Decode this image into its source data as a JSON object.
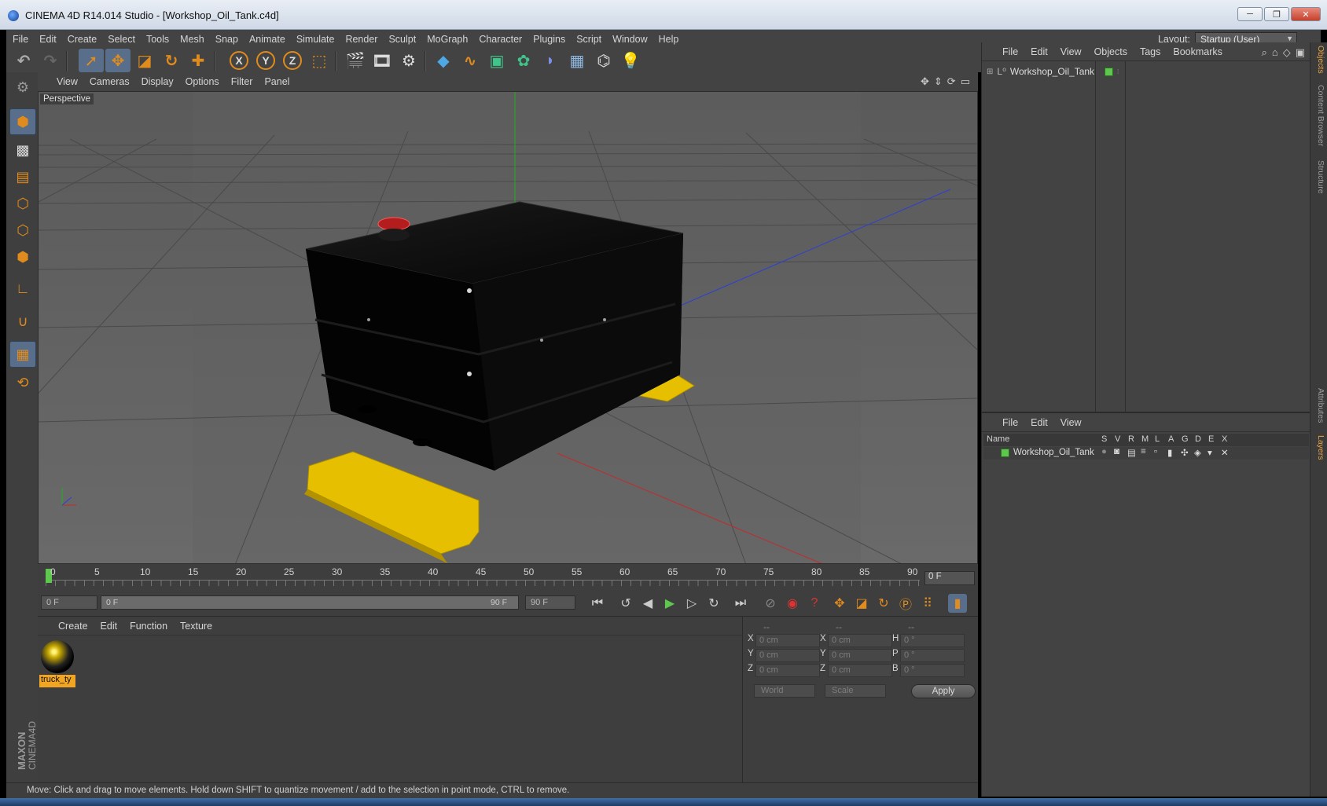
{
  "window": {
    "title": "CINEMA 4D R14.014 Studio - [Workshop_Oil_Tank.c4d]",
    "controls": [
      "─",
      "❐",
      "✕"
    ]
  },
  "menubar": {
    "items": [
      "File",
      "Edit",
      "Create",
      "Select",
      "Tools",
      "Mesh",
      "Snap",
      "Animate",
      "Simulate",
      "Render",
      "Sculpt",
      "MoGraph",
      "Character",
      "Plugins",
      "Script",
      "Window",
      "Help"
    ],
    "layout_label": "Layout:",
    "layout_value": "Startup (User)"
  },
  "toolbar": {
    "axis_labels": [
      "X",
      "Y",
      "Z"
    ],
    "icons": [
      "undo-icon",
      "redo-icon",
      "live-selection-icon",
      "move-icon",
      "scale-icon",
      "rotate-icon",
      "add-icon",
      "x-axis-icon",
      "y-axis-icon",
      "z-axis-icon",
      "coordinate-system-icon",
      "render-view-icon",
      "render-picture-viewer-icon",
      "edit-render-settings-icon",
      "cube-icon",
      "spline-icon",
      "nurbs-icon",
      "array-icon",
      "deformer-icon",
      "floor-icon",
      "camera-icon",
      "light-icon"
    ]
  },
  "viewport": {
    "menu": [
      "View",
      "Cameras",
      "Display",
      "Options",
      "Filter",
      "Panel"
    ],
    "label": "Perspective",
    "nav_icons": [
      "move-view-icon",
      "zoom-view-icon",
      "rotate-view-icon",
      "maximize-view-icon"
    ]
  },
  "timeline": {
    "ticks": [
      "0",
      "5",
      "10",
      "15",
      "20",
      "25",
      "30",
      "35",
      "40",
      "45",
      "50",
      "55",
      "60",
      "65",
      "70",
      "75",
      "80",
      "85",
      "90"
    ],
    "current_frame": "0 F"
  },
  "transport": {
    "start_field": "0 F",
    "range_start": "0 F",
    "range_end": "90 F",
    "end_field": "90 F"
  },
  "material_panel": {
    "menu": [
      "Create",
      "Edit",
      "Function",
      "Texture"
    ],
    "material_name": "truck_ty"
  },
  "coordinates": {
    "headers": [
      "--",
      "--",
      "--"
    ],
    "rows": [
      {
        "l1": "X",
        "v1": "0 cm",
        "l2": "X",
        "v2": "0 cm",
        "l3": "H",
        "v3": "0 °"
      },
      {
        "l1": "Y",
        "v1": "0 cm",
        "l2": "Y",
        "v2": "0 cm",
        "l3": "P",
        "v3": "0 °"
      },
      {
        "l1": "Z",
        "v1": "0 cm",
        "l2": "Z",
        "v2": "0 cm",
        "l3": "B",
        "v3": "0 °"
      }
    ],
    "mode_dropdown": "World",
    "type_dropdown": "Scale",
    "apply_label": "Apply"
  },
  "statusbar": {
    "text": "Move: Click and drag to move elements. Hold down SHIFT to quantize movement / add to the selection in point mode, CTRL to remove."
  },
  "object_manager": {
    "menu": [
      "File",
      "Edit",
      "View",
      "Objects",
      "Tags",
      "Bookmarks"
    ],
    "object_name": "Workshop_Oil_Tank"
  },
  "layer_manager": {
    "menu": [
      "File",
      "Edit",
      "View"
    ],
    "columns": [
      "Name",
      "S",
      "V",
      "R",
      "M",
      "L",
      "A",
      "G",
      "D",
      "E",
      "X"
    ],
    "layer_name": "Workshop_Oil_Tank"
  },
  "right_tabs": [
    "Objects",
    "Content Browser",
    "Structure",
    "Attributes",
    "Layers"
  ],
  "branding": {
    "maxon": "MAXON",
    "product": "CINEMA4D"
  },
  "colors": {
    "accent_orange": "#e08b1d",
    "layer_green": "#5ec84e",
    "tank_yellow": "#e6c000",
    "panel_bg": "#434343"
  }
}
